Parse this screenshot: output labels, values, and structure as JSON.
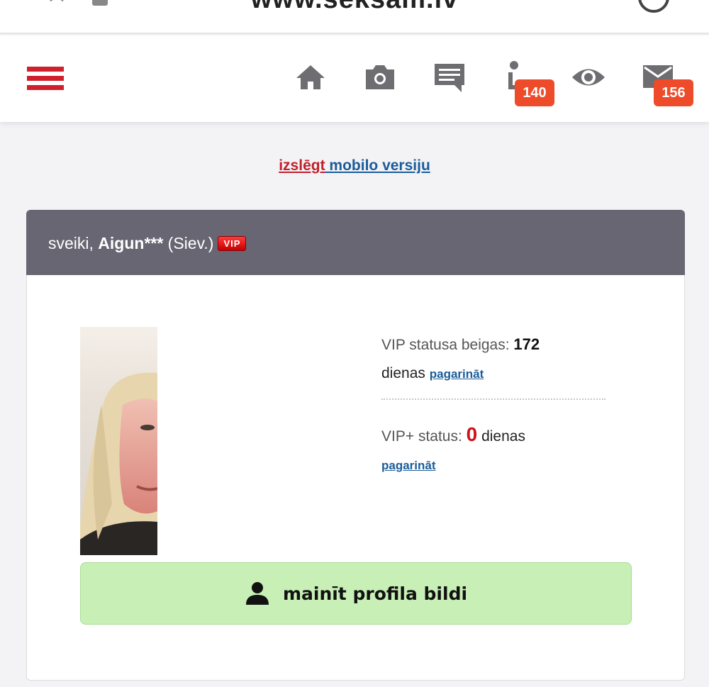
{
  "browser": {
    "url": "www.seksam.lv"
  },
  "header": {
    "nav": [
      {
        "icon": "home-icon"
      },
      {
        "icon": "camera-icon"
      },
      {
        "icon": "chat-icon"
      },
      {
        "icon": "visitor-icon",
        "badge": "140"
      },
      {
        "icon": "eye-icon"
      },
      {
        "icon": "mail-icon",
        "badge": "156"
      }
    ],
    "accent": "#d0202b",
    "badge_color": "#ee4b2a"
  },
  "mobile_toggle": {
    "part1": "izslēgt",
    "part2": " mobilo versiju"
  },
  "card": {
    "greeting_prefix": "sveiki, ",
    "username": "Aigun***",
    "gender": " (Siev.)",
    "vip_badge": "VIP",
    "vip_status_label": "VIP statusa beigas: ",
    "vip_days_value": "172",
    "vip_days_unit": "dienas",
    "extend_label": "pagarināt",
    "vipplus_label": "VIP+ status: ",
    "vipplus_value": "0",
    "vipplus_unit": " dienas",
    "extend_label_2": "pagarināt",
    "change_photo_label": "mainīt profila bildi"
  }
}
